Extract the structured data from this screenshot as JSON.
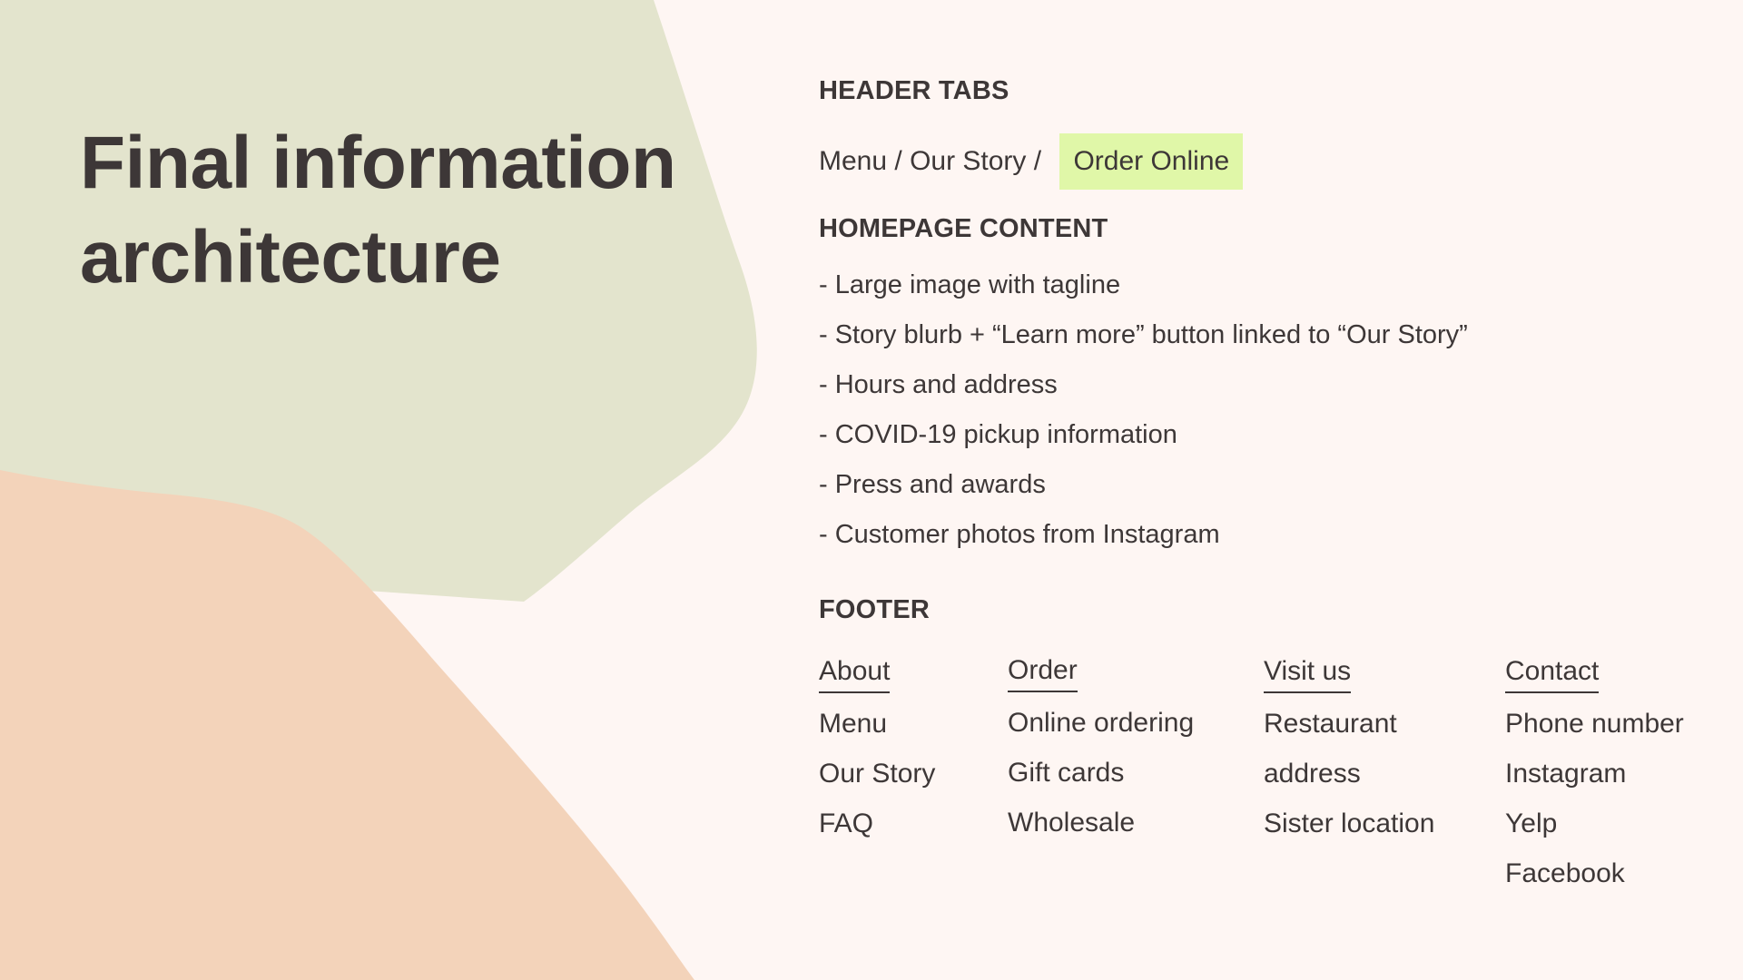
{
  "slide": {
    "title_line1": "Final information",
    "title_line2": "architecture",
    "colors": {
      "background": "#fef6f3",
      "green_blob": "#e3e4cd",
      "peach_blob": "#f3d3ba",
      "highlight": "#e0f7a8",
      "text": "#3d3737"
    }
  },
  "header_tabs": {
    "heading": "HEADER TABS",
    "tab_menu": "Menu",
    "tab_our_story": "Our Story",
    "separator": " / ",
    "tab_order_online": "Order Online"
  },
  "homepage_content": {
    "heading": "HOMEPAGE CONTENT",
    "items": [
      "- Large image with tagline",
      "- Story blurb + “Learn more” button linked to “Our Story”",
      "- Hours and address",
      "- COVID-19 pickup information",
      "- Press and awards",
      "- Customer photos from Instagram"
    ]
  },
  "footer": {
    "heading": "FOOTER",
    "columns": [
      {
        "title": "About",
        "items": [
          "Menu",
          "Our Story",
          "FAQ"
        ]
      },
      {
        "title": "Order",
        "items": [
          "Online ordering",
          "Gift cards",
          "Wholesale"
        ]
      },
      {
        "title": "Visit us",
        "items": [
          "Restaurant",
          "address",
          "Sister location"
        ]
      },
      {
        "title": "Contact",
        "items": [
          "Phone number",
          "Instagram",
          "Yelp",
          "Facebook"
        ]
      }
    ]
  }
}
